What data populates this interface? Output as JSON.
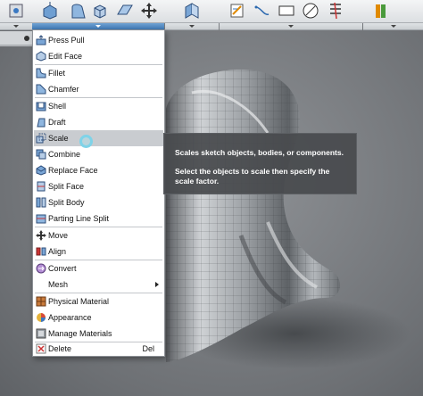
{
  "colors": {
    "menu_highlight": "#c9ccd0",
    "tooltip_bg": "#484a4d",
    "toolbar_bg": "#e6e8ea",
    "active_dropdown": "#4a82bd"
  },
  "toolbar": {
    "icons": [
      "sketch-icon",
      "extrude-icon",
      "revolve-icon",
      "box-icon",
      "plane-icon",
      "move-icon",
      "joint-icon",
      "sketch-dimension-icon",
      "line-icon",
      "rectangle-icon",
      "circle-icon",
      "trim-icon",
      "offset-icon"
    ]
  },
  "menu": {
    "items": [
      {
        "label": "Press Pull",
        "icon": "press-pull-icon"
      },
      {
        "label": "Edit Face",
        "icon": "edit-face-icon"
      },
      {
        "label": "Fillet",
        "icon": "fillet-icon"
      },
      {
        "label": "Chamfer",
        "icon": "chamfer-icon"
      },
      {
        "label": "Shell",
        "icon": "shell-icon"
      },
      {
        "label": "Draft",
        "icon": "draft-icon"
      },
      {
        "label": "Scale",
        "icon": "scale-icon"
      },
      {
        "label": "Combine",
        "icon": "combine-icon"
      },
      {
        "label": "Replace Face",
        "icon": "replace-face-icon"
      },
      {
        "label": "Split Face",
        "icon": "split-face-icon"
      },
      {
        "label": "Split Body",
        "icon": "split-body-icon"
      },
      {
        "label": "Parting Line Split",
        "icon": "parting-line-split-icon"
      },
      {
        "label": "Move",
        "icon": "move-icon"
      },
      {
        "label": "Align",
        "icon": "align-icon"
      },
      {
        "label": "Convert",
        "icon": "convert-icon"
      },
      {
        "label": "Mesh",
        "icon": ""
      },
      {
        "label": "Physical Material",
        "icon": "physical-material-icon"
      },
      {
        "label": "Appearance",
        "icon": "appearance-icon"
      },
      {
        "label": "Manage Materials",
        "icon": "manage-materials-icon"
      },
      {
        "label": "Delete",
        "icon": "delete-icon",
        "shortcut": "Del"
      }
    ],
    "highlighted": "Scale"
  },
  "tooltip": {
    "line1": "Scales sketch objects, bodies, or components.",
    "line2": "Select the objects to scale then specify the scale factor."
  }
}
